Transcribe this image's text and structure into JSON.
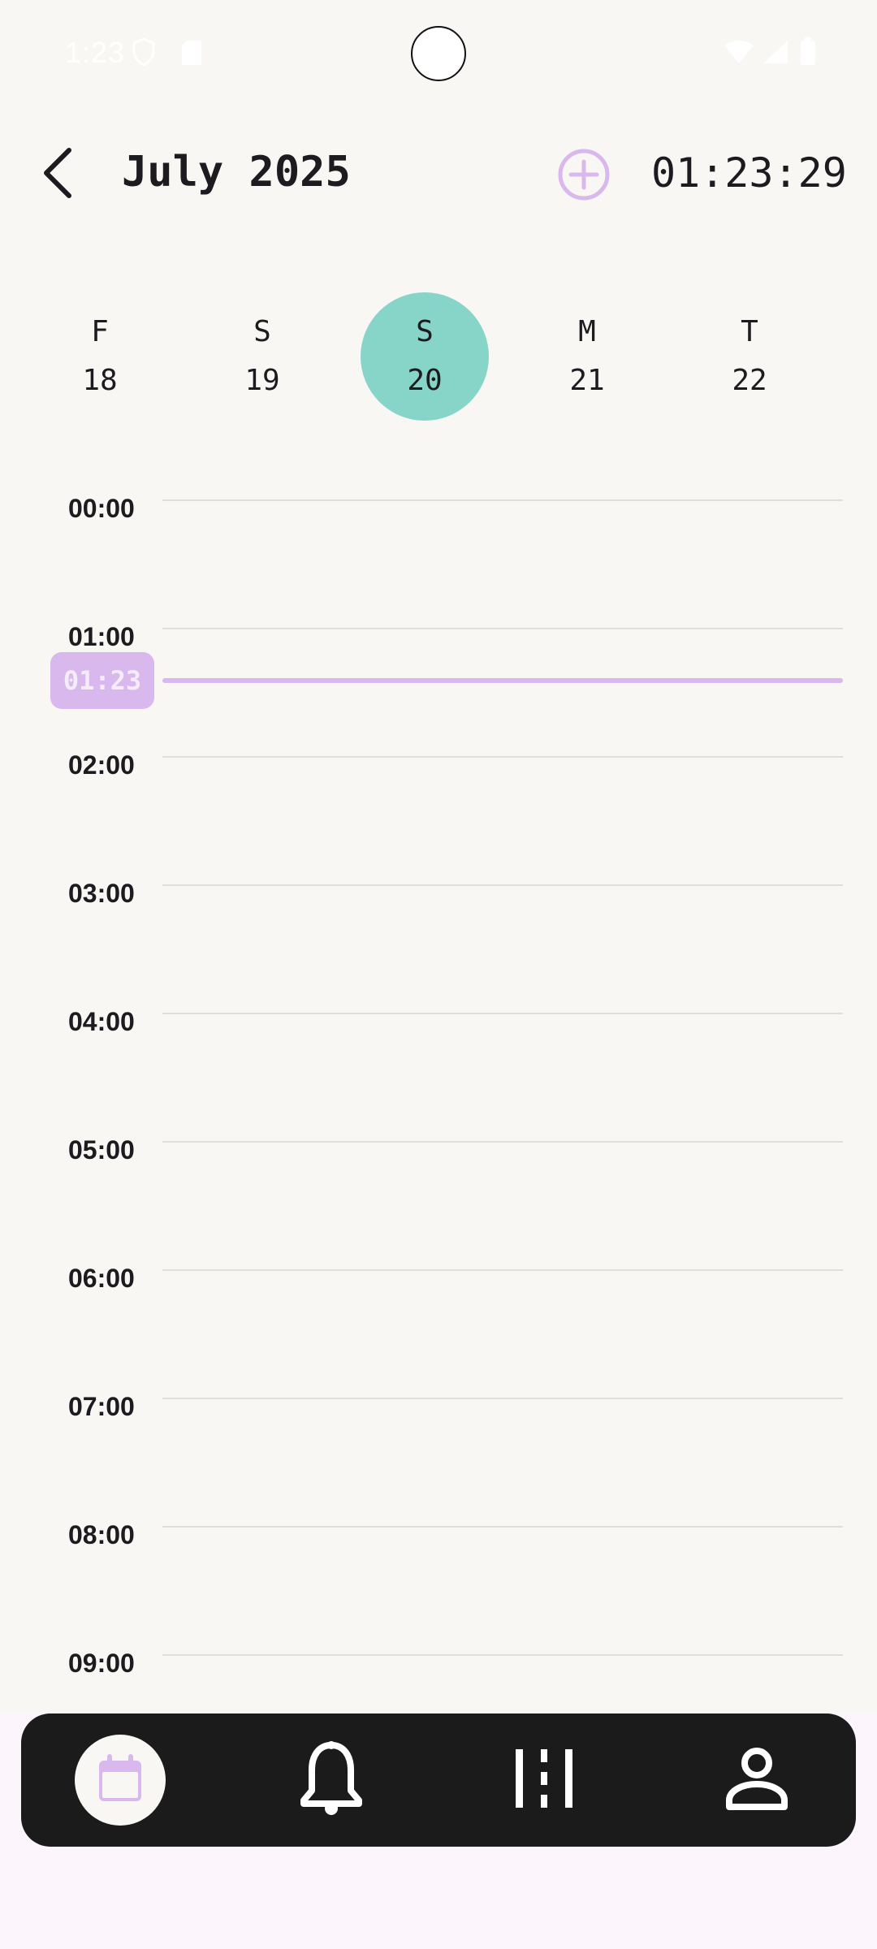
{
  "status_bar": {
    "time": "1:23",
    "icons": [
      "shield-icon",
      "sd-card-icon",
      "wifi-icon",
      "signal-icon",
      "battery-icon"
    ]
  },
  "header": {
    "back_icon": "chevron-left-icon",
    "title": "July 2025",
    "add_icon": "add-circle-icon",
    "clock": "01:23:29"
  },
  "days": [
    {
      "letter": "F",
      "date": "18",
      "selected": false
    },
    {
      "letter": "S",
      "date": "19",
      "selected": false
    },
    {
      "letter": "S",
      "date": "20",
      "selected": true
    },
    {
      "letter": "M",
      "date": "21",
      "selected": false
    },
    {
      "letter": "T",
      "date": "22",
      "selected": false
    }
  ],
  "timeline": {
    "hours": [
      "00:00",
      "01:00",
      "02:00",
      "03:00",
      "04:00",
      "05:00",
      "06:00",
      "07:00",
      "08:00",
      "09:00"
    ],
    "now_label": "01:23"
  },
  "bottom_nav": {
    "items": [
      {
        "icon": "calendar-icon",
        "active": true
      },
      {
        "icon": "bell-icon",
        "active": false
      },
      {
        "icon": "columns-icon",
        "active": false
      },
      {
        "icon": "person-icon",
        "active": false
      }
    ]
  },
  "colors": {
    "background": "#F9F7F3",
    "accent_purple": "#D9B8EE",
    "selected_day": "#87D5C9",
    "nav_background": "#1B1B1B"
  }
}
